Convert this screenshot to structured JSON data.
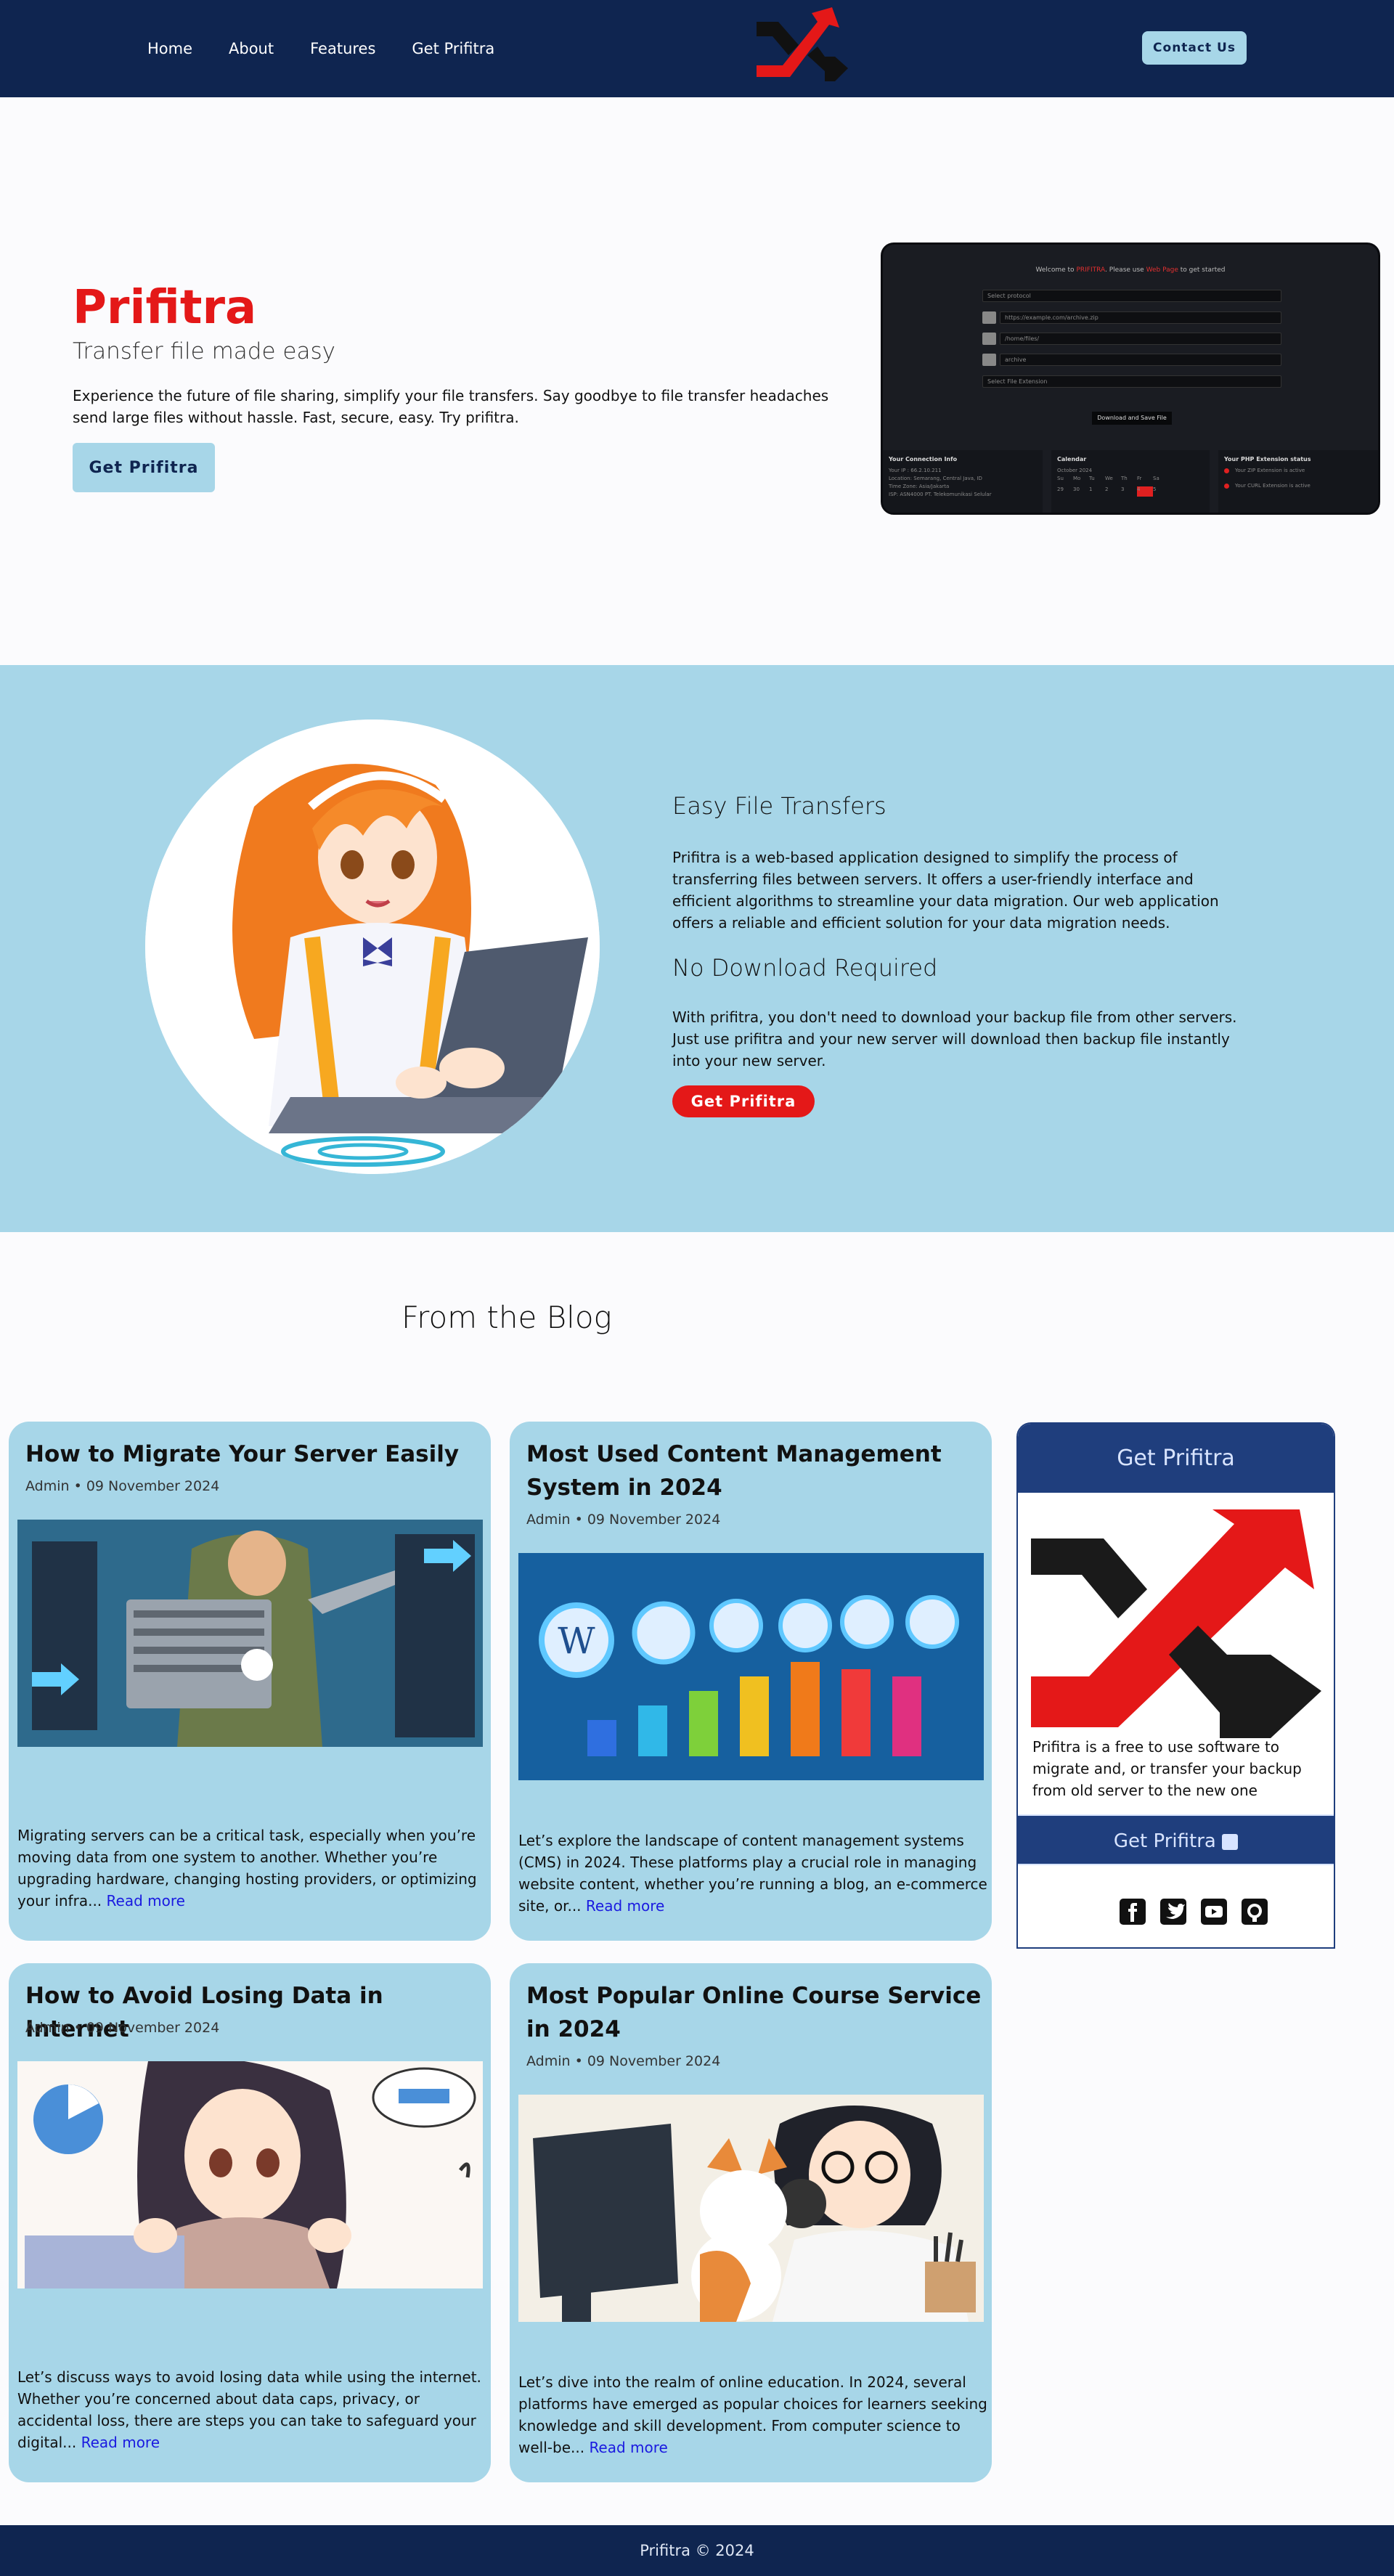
{
  "nav": {
    "links": [
      "Home",
      "About",
      "Features",
      "Get Prifitra"
    ],
    "contact_label": "Contact Us"
  },
  "hero": {
    "title": "Prifitra",
    "subtitle": "Transfer file made easy",
    "description": "Experience the future of file sharing, simplify your file transfers. Say goodbye to file transfer headaches send large files without hassle. Fast, secure, easy. Try prifitra.",
    "button_label": "Get Prifitra",
    "screenshot": {
      "welcome_pre": "Welcome to",
      "welcome_brand": "PRIFITRA",
      "welcome_mid": ". Please use",
      "welcome_link": "Web Page",
      "welcome_post": "to get started",
      "field_protocol": "Select protocol",
      "field_url": "https://example.com/archive.zip",
      "field_path": "/home/files/",
      "field_name": "archive",
      "field_ext": "Select File Extension",
      "download_label": "Download and Save File",
      "panel_conn_title": "Your Connection Info",
      "panel_conn_lines": [
        "Your IP : 66.2.10.211",
        "Location: Semarang, Central Java, ID",
        "Time Zone: Asia/Jakarta",
        "ISP: ASN4000 PT. Telekomunikasi Selular"
      ],
      "panel_cal_title": "Calendar",
      "panel_cal_month": "October 2024",
      "panel_cal_days": [
        "Su",
        "Mo",
        "Tu",
        "We",
        "Th",
        "Fr",
        "Sa"
      ],
      "panel_cal_dates": [
        "29",
        "30",
        "1",
        "2",
        "3",
        "4",
        "5"
      ],
      "panel_php_title": "Your PHP Extension status",
      "panel_php_lines": [
        "Your ZIP Extension is active",
        "Your CURL Extension is active"
      ]
    }
  },
  "features": {
    "heading1": "Easy File Transfers",
    "text1": "Prifitra is a web-based application designed to simplify the process of transferring files between servers. It offers a user-friendly interface and efficient algorithms to streamline your data migration. Our web application offers a reliable and efficient solution for your data migration needs.",
    "heading2": "No Download Required",
    "text2": "With prifitra, you don't need to download your backup file from other servers. Just use prifitra and your new server will download then backup file instantly into your new server.",
    "button_label": "Get Prifitra"
  },
  "blog": {
    "heading": "From the Blog",
    "read_more": "Read more",
    "posts": [
      {
        "title": "How to Migrate Your Server Easily",
        "meta": "Admin • 09 November 2024",
        "excerpt": "Migrating servers can be a critical task, especially when you’re moving data from one system to another. Whether you’re upgrading hardware, changing hosting providers, or optimizing your infra..."
      },
      {
        "title": "Most Used Content Management System in 2024",
        "meta": "Admin • 09 November 2024",
        "excerpt": "Let’s explore the landscape of content management systems (CMS) in 2024. These platforms play a crucial role in managing website content, whether you’re running a blog, an e-commerce site, or..."
      },
      {
        "title": "How to Avoid Losing Data in Internet",
        "meta": "Admin • 09 November 2024",
        "excerpt": "Let’s discuss ways to avoid losing data while using the internet. Whether you’re concerned about data caps, privacy, or accidental loss, there are steps you can take to safeguard your digital..."
      },
      {
        "title": "Most Popular Online Course Service in 2024",
        "meta": "Admin • 09 November 2024",
        "excerpt": "Let’s dive into the realm of online education. In 2024, several platforms have emerged as popular choices for learners seeking knowledge and skill development. From computer science to well-be..."
      }
    ]
  },
  "sidebar": {
    "title": "Get Prifitra",
    "text": "Prifitra is a free to use software to migrate and, or transfer your backup from old server to the new one",
    "button_label": "Get Prifitra",
    "social_icons": [
      "facebook-icon",
      "twitter-icon",
      "youtube-icon",
      "github-icon"
    ]
  },
  "footer": {
    "text": "Prifitra © 2024"
  },
  "colors": {
    "navy": "#0f2550",
    "accent_red": "#e41818",
    "light_blue": "#a7d6e8",
    "sidebar_blue": "#1f3e7d"
  }
}
